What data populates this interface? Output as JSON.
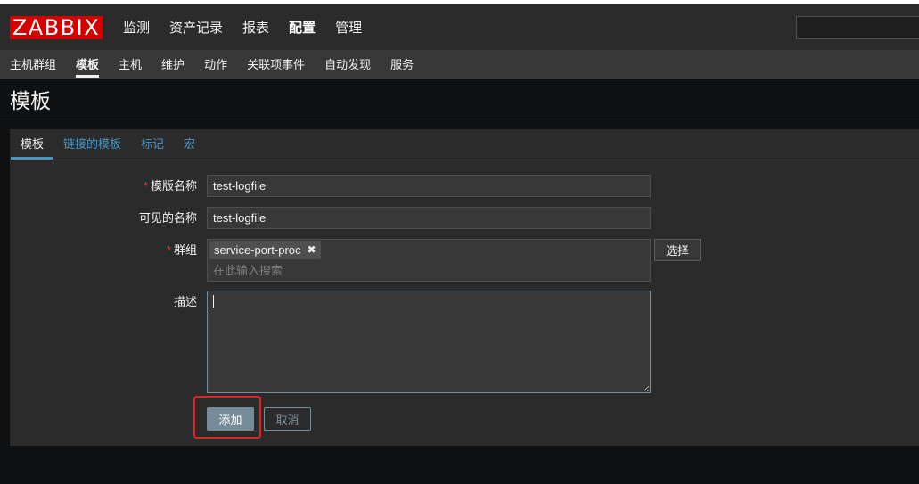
{
  "header": {
    "logo_text": "ZABBIX",
    "nav": [
      {
        "label": "监测"
      },
      {
        "label": "资产记录"
      },
      {
        "label": "报表"
      },
      {
        "label": "配置",
        "active": true
      },
      {
        "label": "管理"
      }
    ]
  },
  "subnav": {
    "items": [
      {
        "label": "主机群组"
      },
      {
        "label": "模板",
        "active": true
      },
      {
        "label": "主机"
      },
      {
        "label": "维护"
      },
      {
        "label": "动作"
      },
      {
        "label": "关联项事件"
      },
      {
        "label": "自动发现"
      },
      {
        "label": "服务"
      }
    ]
  },
  "page": {
    "title": "模板"
  },
  "tabs": [
    {
      "label": "模板",
      "active": true
    },
    {
      "label": "链接的模板"
    },
    {
      "label": "标记"
    },
    {
      "label": "宏"
    }
  ],
  "form": {
    "required_mark": "*",
    "template_name": {
      "label": "模版名称",
      "value": "test-logfile",
      "required": true
    },
    "visible_name": {
      "label": "可见的名称",
      "value": "test-logfile"
    },
    "groups": {
      "label": "群组",
      "required": true,
      "selected": [
        {
          "name": "service-port-proc",
          "remove_icon": "close-icon"
        }
      ],
      "placeholder": "在此输入搜索",
      "select_button": "选择"
    },
    "description": {
      "label": "描述"
    },
    "add_button": "添加",
    "cancel_button": "取消"
  },
  "colors": {
    "logo_bg": "#d40000",
    "accent": "#4796c4",
    "required": "#e33734",
    "highlight": "#e0251c",
    "button": "#768d99"
  }
}
